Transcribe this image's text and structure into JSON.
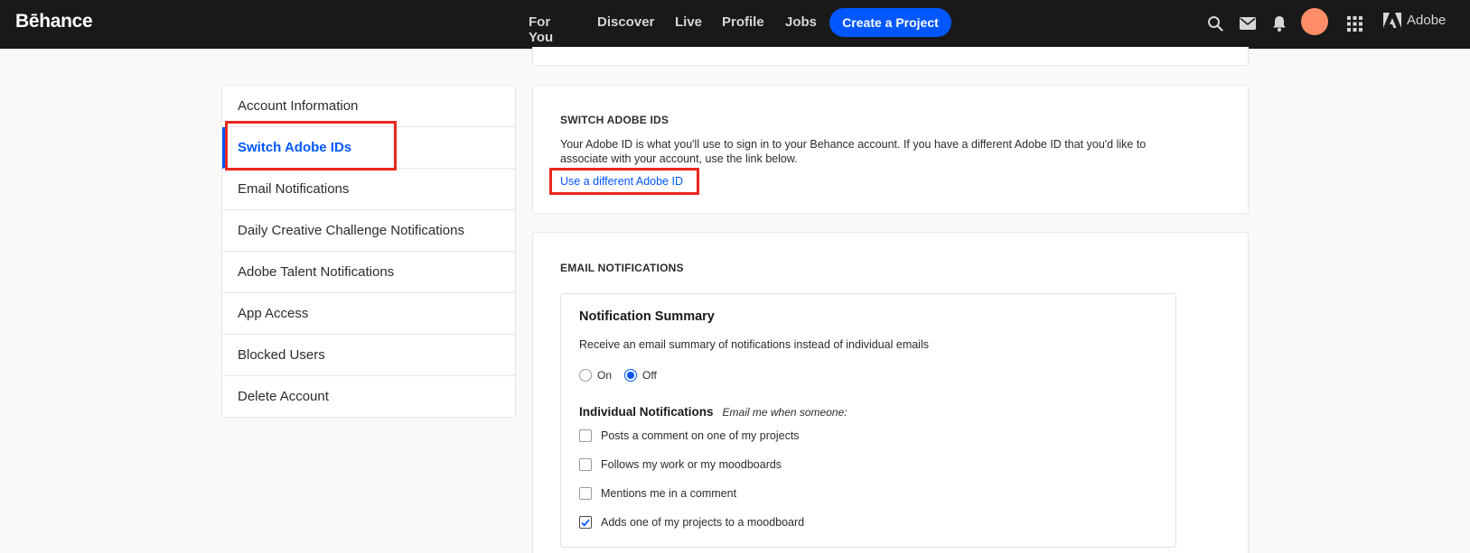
{
  "header": {
    "logo": "Bēhance",
    "nav": [
      "For You",
      "Discover",
      "Live",
      "Profile",
      "Jobs"
    ],
    "create_label": "Create a Project",
    "adobe_label": "Adobe",
    "accent": "#0057ff",
    "avatar_color": "#ff8e68"
  },
  "sidebar": {
    "items": [
      {
        "label": "Account Information",
        "active": false
      },
      {
        "label": "Switch Adobe IDs",
        "active": true
      },
      {
        "label": "Email Notifications",
        "active": false
      },
      {
        "label": "Daily Creative Challenge Notifications",
        "active": false
      },
      {
        "label": "Adobe Talent Notifications",
        "active": false
      },
      {
        "label": "App Access",
        "active": false
      },
      {
        "label": "Blocked Users",
        "active": false
      },
      {
        "label": "Delete Account",
        "active": false
      }
    ]
  },
  "switch_ids": {
    "title": "SWITCH ADOBE IDS",
    "description": "Your Adobe ID is what you'll use to sign in to your Behance account. If you have a different Adobe ID that you'd like to associate with your account, use the link below.",
    "link": "Use a different Adobe ID"
  },
  "email": {
    "title": "EMAIL NOTIFICATIONS",
    "summary_title": "Notification Summary",
    "summary_desc": "Receive an email summary of notifications instead of individual emails",
    "radio_on": "On",
    "radio_off": "Off",
    "selected": "Off",
    "individual_title": "Individual Notifications",
    "individual_sub": "Email me when someone:",
    "options": [
      {
        "label": "Posts a comment on one of my projects",
        "checked": false
      },
      {
        "label": "Follows my work or my moodboards",
        "checked": false
      },
      {
        "label": "Mentions me in a comment",
        "checked": false
      },
      {
        "label": "Adds one of my projects to a moodboard",
        "checked": true
      }
    ]
  },
  "highlight_color": "#e8281c"
}
